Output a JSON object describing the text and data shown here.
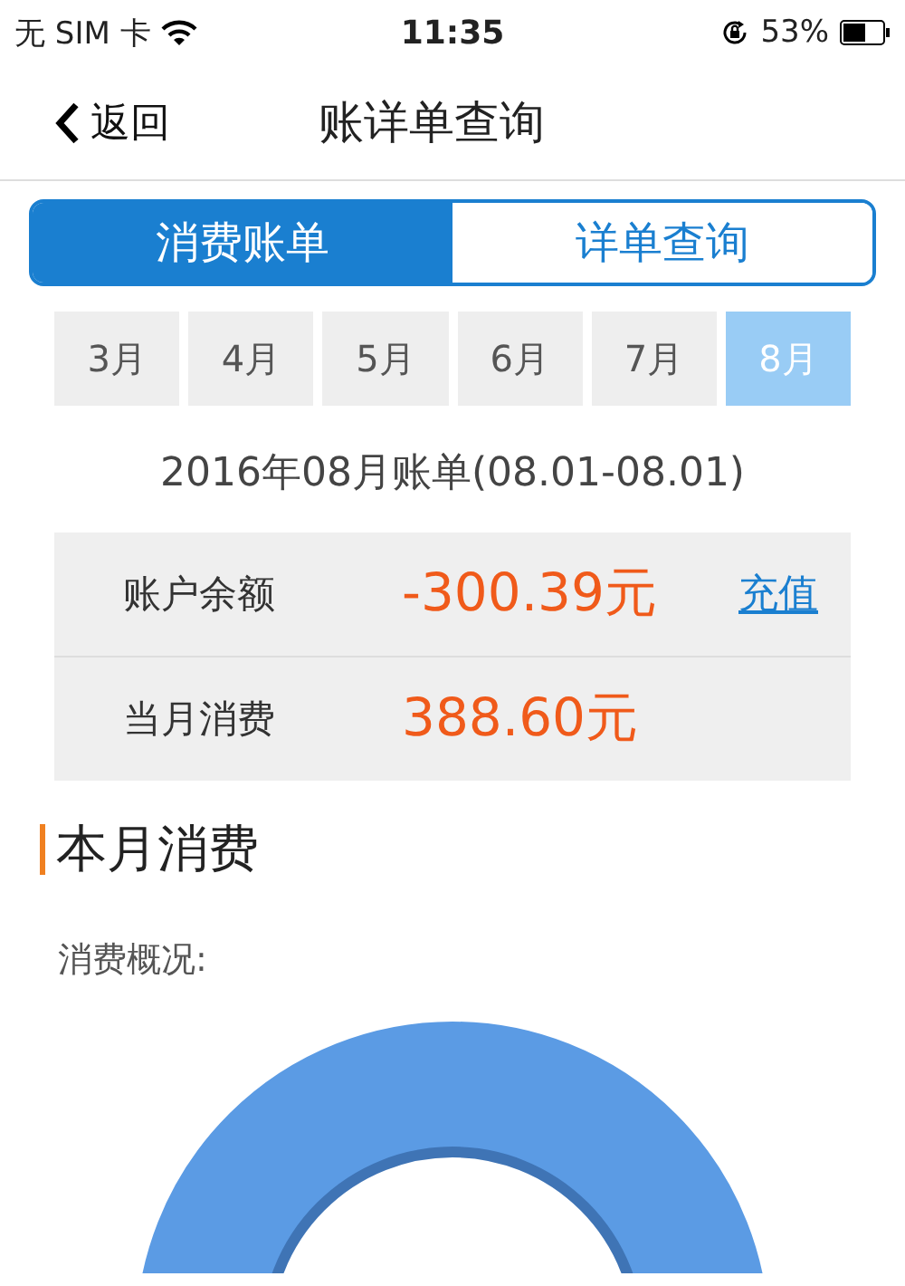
{
  "status_bar": {
    "carrier": "无 SIM 卡",
    "time": "11:35",
    "battery": "53%"
  },
  "nav": {
    "back": "返回",
    "title": "账详单查询"
  },
  "segments": [
    {
      "label": "消费账单",
      "selected": true
    },
    {
      "label": "详单查询",
      "selected": false
    }
  ],
  "months": [
    {
      "label": "3月",
      "selected": false
    },
    {
      "label": "4月",
      "selected": false
    },
    {
      "label": "5月",
      "selected": false
    },
    {
      "label": "6月",
      "selected": false
    },
    {
      "label": "7月",
      "selected": false
    },
    {
      "label": "8月",
      "selected": true
    }
  ],
  "period": "2016年08月账单(08.01-08.01)",
  "summary": [
    {
      "label": "账户余额",
      "value": "-300.39元",
      "action": "充值"
    },
    {
      "label": "当月消费",
      "value": "388.60元"
    }
  ],
  "section": {
    "title": "本月消费",
    "subtitle": "消费概况:"
  }
}
